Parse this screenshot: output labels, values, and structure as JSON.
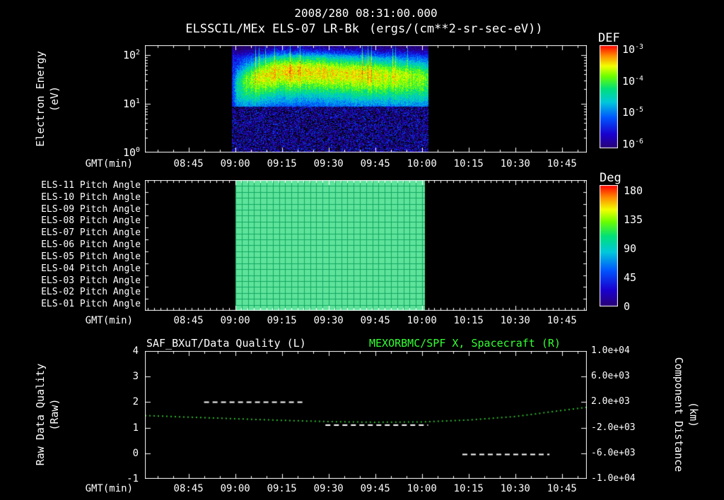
{
  "header": {
    "datetime": "2008/280 08:31:00.000",
    "instrument": "ELSSCIL/MEx ELS-07 LR-Bk",
    "units": "(ergs/(cm**2-sr-sec-eV))"
  },
  "colors": {
    "background": "#000000",
    "foreground": "#ffffff",
    "accent_green": "#33ff33",
    "curve_green": "#2db82d",
    "pitch_fill": "#5fe39b",
    "pitch_grid": "#12a862",
    "colormap_stops": [
      [
        0.0,
        "#2a0070"
      ],
      [
        0.14,
        "#1a00d0"
      ],
      [
        0.3,
        "#0055ff"
      ],
      [
        0.45,
        "#00c8dc"
      ],
      [
        0.58,
        "#00e07a"
      ],
      [
        0.7,
        "#6aff00"
      ],
      [
        0.8,
        "#f2ff00"
      ],
      [
        0.9,
        "#ff8c00"
      ],
      [
        1.0,
        "#ff0000"
      ]
    ]
  },
  "x_axis": {
    "label": "GMT(min)",
    "start": "08:31",
    "end": "10:53",
    "major_ticks": [
      "08:45",
      "09:00",
      "09:15",
      "09:30",
      "09:45",
      "10:00",
      "10:15",
      "10:30",
      "10:45"
    ],
    "minor_tick_minutes": 5
  },
  "chart_data": [
    {
      "type": "heatmap",
      "name": "electron-energy-spectrogram",
      "title": "ELSSCIL/MEx ELS-07 LR-Bk",
      "units": "ergs/(cm**2-sr-sec-eV)",
      "xlabel": "GMT(min)",
      "ylabel": "Electron Energy",
      "ylabel_units": "(eV)",
      "y_scale": "log",
      "y_ticks": [
        "10^0",
        "10^1",
        "10^2"
      ],
      "y_tick_exponents": [
        0,
        1,
        2
      ],
      "y_log_max": 2.2,
      "colorbar": {
        "label": "DEF",
        "ticks": [
          "10^-3",
          "10^-4",
          "10^-5",
          "10^-6"
        ],
        "tick_exponents": [
          -3,
          -4,
          -5,
          -6
        ],
        "log10_range": [
          -6,
          -3
        ]
      },
      "data_window": {
        "start": "08:59",
        "end": "10:02"
      },
      "background_log10_flux": -5.55,
      "band_center_eV": [
        [
          0.0,
          22
        ],
        [
          0.12,
          36
        ],
        [
          0.25,
          48
        ],
        [
          0.4,
          47
        ],
        [
          0.55,
          44
        ],
        [
          0.7,
          41
        ],
        [
          0.85,
          37
        ],
        [
          1.0,
          33
        ]
      ],
      "band_peak_log10_flux": [
        [
          0.0,
          -4.6
        ],
        [
          0.06,
          -4.1
        ],
        [
          0.12,
          -3.7
        ],
        [
          0.2,
          -3.55
        ],
        [
          0.3,
          -3.5
        ],
        [
          0.45,
          -3.55
        ],
        [
          0.6,
          -3.55
        ],
        [
          0.72,
          -3.62
        ],
        [
          0.85,
          -3.72
        ],
        [
          1.0,
          -3.95
        ]
      ]
    },
    {
      "type": "heatmap",
      "name": "pitch-angle-panel",
      "rows": [
        "ELS-11 Pitch Angle",
        "ELS-10 Pitch Angle",
        "ELS-09 Pitch Angle",
        "ELS-08 Pitch Angle",
        "ELS-07 Pitch Angle",
        "ELS-06 Pitch Angle",
        "ELS-05 Pitch Angle",
        "ELS-04 Pitch Angle",
        "ELS-03 Pitch Angle",
        "ELS-02 Pitch Angle",
        "ELS-01 Pitch Angle"
      ],
      "xlabel": "GMT(min)",
      "colorbar": {
        "label": "Deg",
        "ticks": [
          180,
          135,
          90,
          45,
          0
        ],
        "range": [
          0,
          180
        ]
      },
      "data_window": {
        "start": "09:00",
        "end": "10:01"
      },
      "value_deg": 100
    },
    {
      "type": "line",
      "name": "quality-and-distance",
      "title_left": "SAF_BXuT/Data Quality (L)",
      "title_right": "MEXORBMC/SPF X, Spacecraft (R)",
      "xlabel": "GMT(min)",
      "left_axis": {
        "label": "Raw Data Quality",
        "label_units": "(Raw)",
        "ticks": [
          4,
          3,
          2,
          1,
          0,
          -1
        ],
        "range": [
          -1,
          4
        ]
      },
      "right_axis": {
        "label": "Component Distance",
        "label_units": "(km)",
        "ticks": [
          "1.0e+04",
          "6.0e+03",
          "2.0e+03",
          "-2.0e+03",
          "-6.0e+03",
          "-1.0e+04"
        ],
        "range": [
          -10000,
          10000
        ]
      },
      "series": [
        {
          "name": "SAF_BXuT/Data Quality",
          "axis": "left",
          "style": "dashed",
          "color": "#ffffff",
          "segments": [
            {
              "start": "08:50",
              "end": "09:22",
              "value": 2.0
            },
            {
              "start": "09:29",
              "end": "10:02",
              "value": 1.1
            },
            {
              "start": "10:13",
              "end": "10:41",
              "value": -0.05
            }
          ]
        },
        {
          "name": "MEXORBMC/SPF X Spacecraft",
          "axis": "right",
          "style": "dotted",
          "color": "#2db82d",
          "points": [
            [
              "08:31",
              -100
            ],
            [
              "08:45",
              -350
            ],
            [
              "09:00",
              -600
            ],
            [
              "09:15",
              -850
            ],
            [
              "09:30",
              -1050
            ],
            [
              "09:45",
              -1150
            ],
            [
              "10:00",
              -1100
            ],
            [
              "10:15",
              -800
            ],
            [
              "10:30",
              -250
            ],
            [
              "10:45",
              700
            ],
            [
              "10:53",
              1200
            ]
          ]
        }
      ]
    }
  ]
}
